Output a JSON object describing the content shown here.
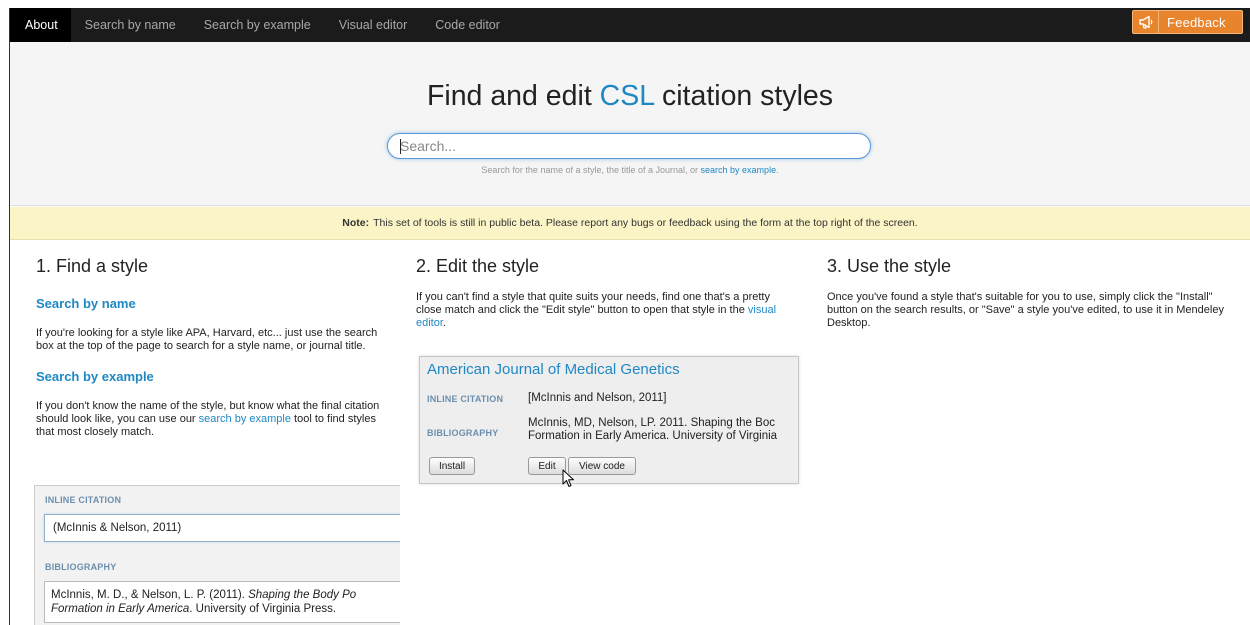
{
  "nav": {
    "tabs": [
      {
        "label": "About",
        "active": true
      },
      {
        "label": "Search by name",
        "active": false
      },
      {
        "label": "Search by example",
        "active": false
      },
      {
        "label": "Visual editor",
        "active": false
      },
      {
        "label": "Code editor",
        "active": false
      }
    ],
    "feedback_label": "Feedback",
    "feedback_icon": "megaphone-icon"
  },
  "hero": {
    "title_prefix": "Find and edit ",
    "title_highlight": "CSL",
    "title_suffix": " citation styles",
    "search_placeholder": "Search...",
    "hint_text": "Search for the name of a style, the title of a Journal, or ",
    "hint_link": "search by example",
    "hint_end": "."
  },
  "beta_note": {
    "label": "Note:",
    "text": "This set of tools is still in public beta. Please report any bugs or feedback using the form at the top right of the screen."
  },
  "find_style": {
    "heading": "1. Find a style",
    "by_name_heading": "Search by name",
    "by_name_text": "If you're looking for a style like APA, Harvard, etc... just use the search box at the top of the page to search for a style name, or journal title.",
    "by_example_heading": "Search by example",
    "by_example_text_1": "If you don't know the name of the style, but know what the final citation should look like, you can use our ",
    "by_example_link": "search by example",
    "by_example_text_2": " tool to find styles that most closely match.",
    "example": {
      "inline_label": "INLINE CITATION",
      "inline_value": "(McInnis & Nelson, 2011)",
      "bib_label": "BIBLIOGRAPHY",
      "bib_line1_plain": "McInnis, M. D., & Nelson, L. P. (2011). ",
      "bib_line1_italic": "Shaping the Body Po",
      "bib_line2_italic": "Formation in Early America",
      "bib_line2_plain": ". University of Virginia Press."
    }
  },
  "edit_style": {
    "heading": "2. Edit the style",
    "text_1": "If you can't find a style that quite suits your needs, find one that's a pretty close match and click the \"Edit style\" button to open that style in the ",
    "link": "visual editor",
    "text_2": ".",
    "card": {
      "title": "American Journal of Medical Genetics",
      "inline_label": "INLINE CITATION",
      "inline_value": "[McInnis and Nelson, 2011]",
      "bib_label": "BIBLIOGRAPHY",
      "bib_line1": "McInnis, MD, Nelson, LP. 2011. Shaping the Boc",
      "bib_line2": "Formation in Early America. University of Virginia",
      "install_label": "Install",
      "edit_label": "Edit",
      "view_code_label": "View code"
    }
  },
  "use_style": {
    "heading": "3. Use the style",
    "text": "Once you've found a style that's suitable for you to use, simply click the \"Install\" button on the search results, or \"Save\" a style you've edited, to use it in Mendeley Desktop."
  },
  "colors": {
    "accent": "#1f88c4",
    "nav_bg": "#1b1b1b",
    "feedback_bg": "#e8842c",
    "note_bg": "#fbf4c6"
  }
}
